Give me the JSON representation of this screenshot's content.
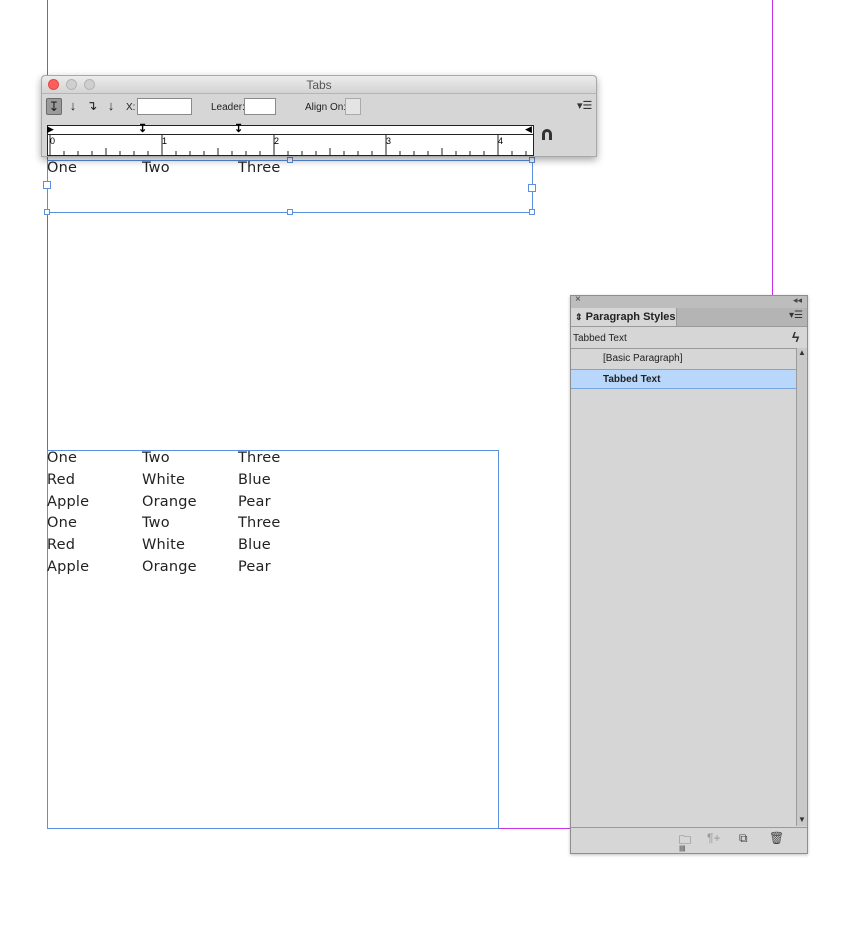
{
  "tabs_panel": {
    "title": "Tabs",
    "x_label": "X:",
    "x_value": "",
    "leader_label": "Leader:",
    "leader_value": "",
    "align_on_label": "Align On:",
    "align_on_value": "",
    "ruler_numbers": [
      "0",
      "1",
      "2",
      "3",
      "4"
    ],
    "tab_buttons": [
      "left-justified-tab",
      "center-justified-tab",
      "right-justified-tab",
      "align-to-decimal-tab"
    ]
  },
  "top_frame": {
    "row": [
      "One",
      "Two",
      "Three"
    ]
  },
  "bottom_frame": {
    "rows": [
      [
        "One",
        "Two",
        "Three"
      ],
      [
        "Red",
        "White",
        "Blue"
      ],
      [
        "Apple",
        "Orange",
        "Pear"
      ],
      [
        "One",
        "Two",
        "Three"
      ],
      [
        "Red",
        "White",
        "Blue"
      ],
      [
        "Apple",
        "Orange",
        "Pear"
      ]
    ]
  },
  "paragraph_styles": {
    "tab_label": "Paragraph Styles",
    "current_style": "Tabbed Text",
    "items": [
      {
        "label": "[Basic Paragraph]",
        "selected": false
      },
      {
        "label": "Tabbed Text",
        "selected": true
      }
    ]
  },
  "colors": {
    "guide": "#c832e6",
    "frame": "#5b8fe0",
    "selection": "#b9d7fb"
  }
}
